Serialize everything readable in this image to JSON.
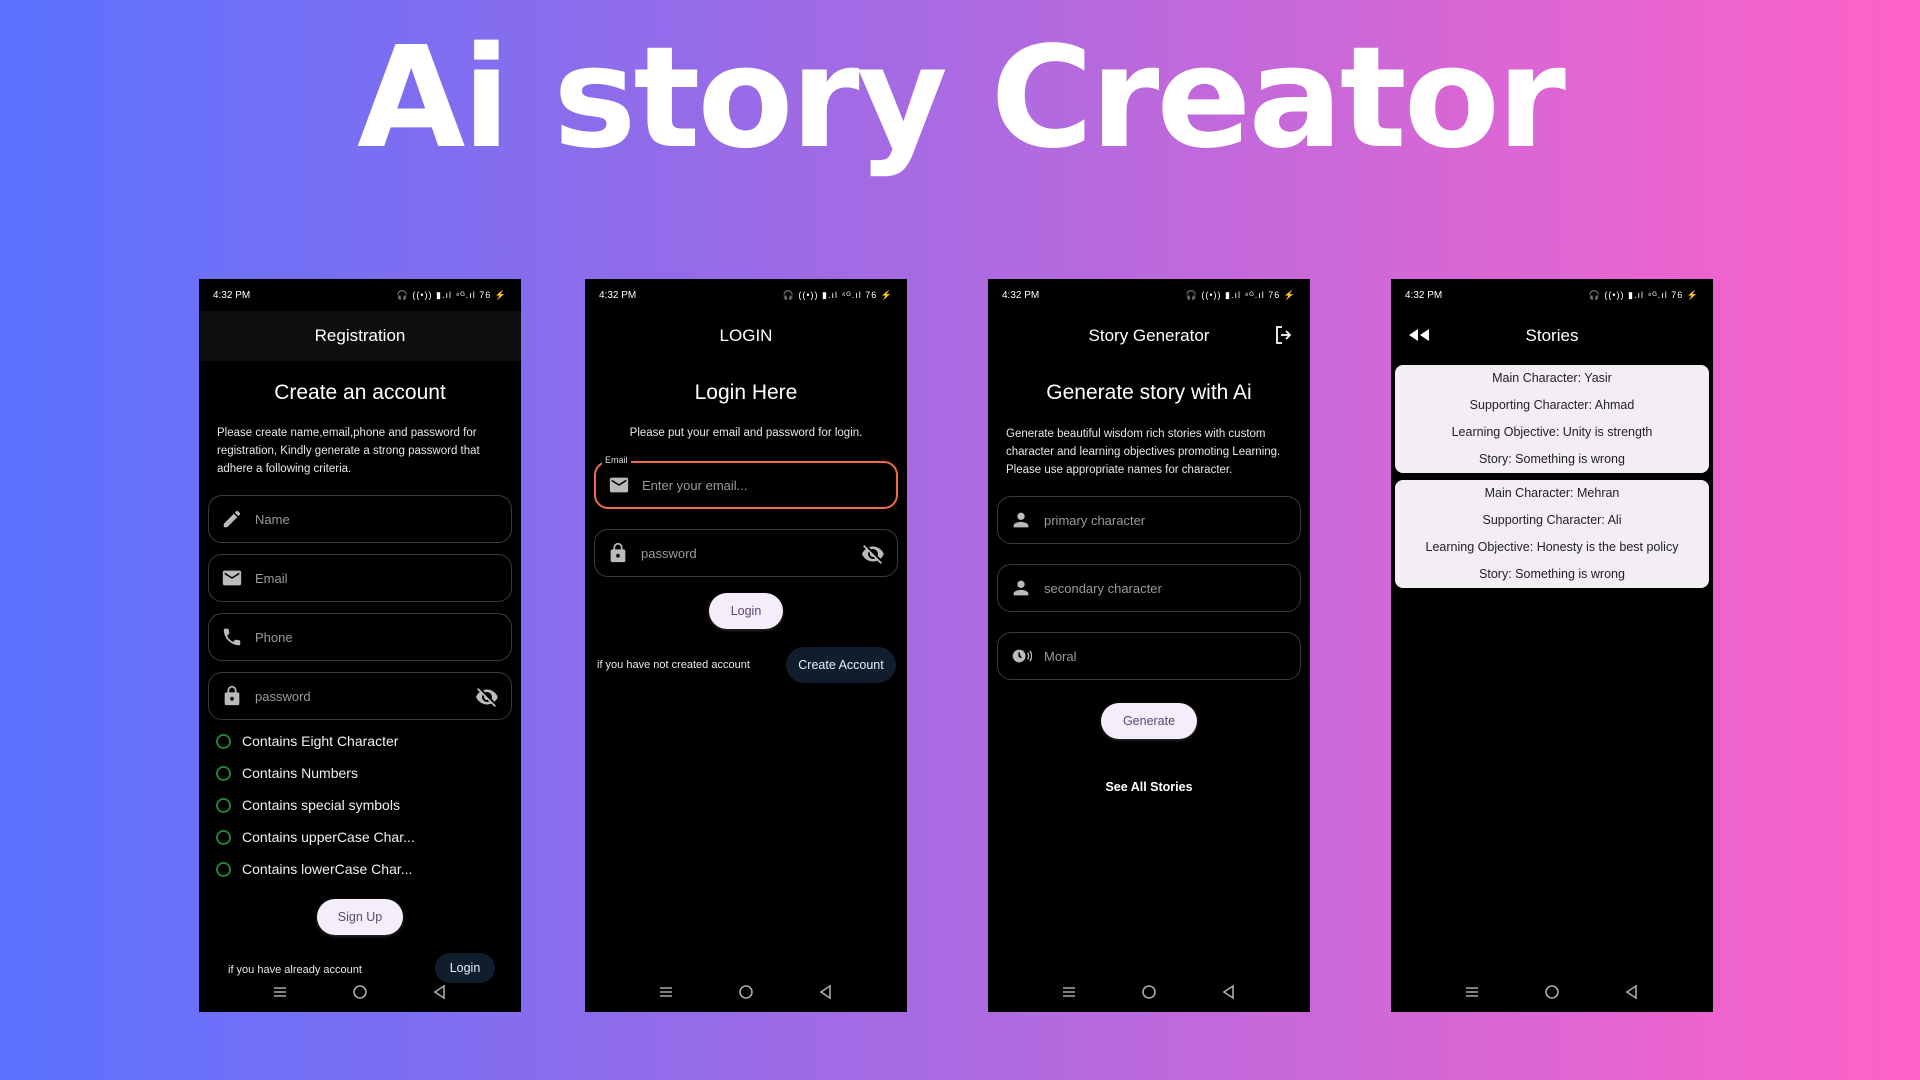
{
  "banner": {
    "title": "Ai story Creator"
  },
  "status": {
    "time": "4:32 PM",
    "indicators": "🎧 ((•)) ▮.ıl ⁴ᴳ.ıl 76 ⚡"
  },
  "registration": {
    "appbar_title": "Registration",
    "heading": "Create an account",
    "description": "Please create name,email,phone and password for registration, Kindly generate a strong password that adhere a following criteria.",
    "fields": {
      "name": "Name",
      "email": "Email",
      "phone": "Phone",
      "password": "password"
    },
    "criteria": [
      "Contains Eight Character",
      "Contains Numbers",
      "Contains special symbols",
      "Contains upperCase Char...",
      "Contains lowerCase Char..."
    ],
    "signup_label": "Sign Up",
    "already_account_text": "if you have already account",
    "login_label": "Login"
  },
  "login": {
    "appbar_title": "LOGIN",
    "heading": "Login Here",
    "description": "Please put your email and password for login.",
    "email_label": "Email",
    "email_placeholder": "Enter your email...",
    "password_placeholder": "password",
    "login_label": "Login",
    "no_account_text": "if you have not created account",
    "create_account_label": "Create Account",
    "accent_color": "#f16a4b"
  },
  "generator": {
    "appbar_title": "Story Generator",
    "heading": "Generate story with Ai",
    "description": "Generate beautiful wisdom rich stories with custom character and learning objectives promoting Learning. Please use appropriate names for character.",
    "fields": {
      "primary": "primary character",
      "secondary": "secondary character",
      "moral": "Moral"
    },
    "generate_label": "Generate",
    "see_all_label": "See All Stories"
  },
  "stories": {
    "appbar_title": "Stories",
    "items": [
      {
        "main": "Main Character: Yasir",
        "supporting": "Supporting Character: Ahmad",
        "objective": "Learning Objective: Unity is strength",
        "story": "Story: Something is wrong"
      },
      {
        "main": "Main Character: Mehran",
        "supporting": "Supporting Character: Ali",
        "objective": "Learning Objective: Honesty is the best policy",
        "story": "Story: Something is wrong"
      }
    ]
  }
}
